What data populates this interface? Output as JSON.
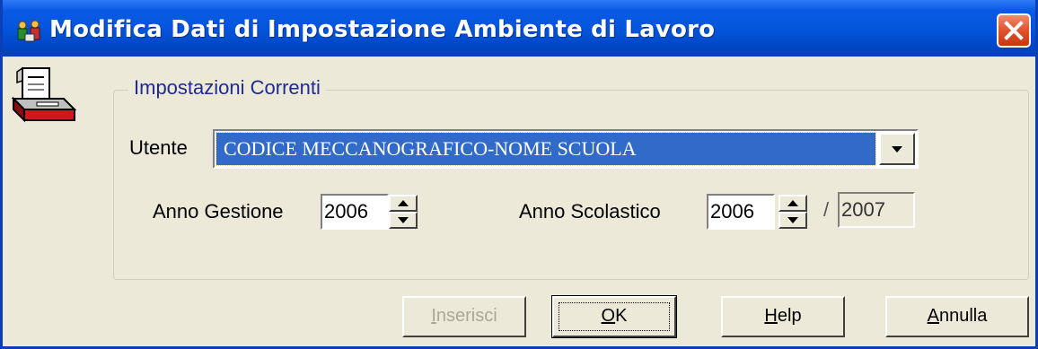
{
  "window": {
    "title": "Modifica Dati di Impostazione Ambiente di Lavoro",
    "title_icon": "people-settings-icon",
    "close_icon": "close-icon",
    "app_icon": "printer-document-icon"
  },
  "group": {
    "legend": "Impostazioni Correnti"
  },
  "utente": {
    "label": "Utente",
    "value": "CODICE MECCANOGRAFICO-NOME SCUOLA",
    "dropdown_icon": "chevron-down-icon"
  },
  "anno_gestione": {
    "label": "Anno Gestione",
    "value": "2006"
  },
  "anno_scolastico": {
    "label": "Anno Scolastico",
    "value_from": "2006",
    "separator": "/",
    "value_to": "2007"
  },
  "buttons": {
    "inserisci": {
      "label": "Inserisci",
      "mnemonic": "I",
      "rest": "nserisci",
      "enabled": false
    },
    "ok": {
      "label": "OK",
      "mnemonic": "O",
      "rest": "K"
    },
    "help": {
      "label": "Help",
      "mnemonic": "H",
      "rest": "elp"
    },
    "annulla": {
      "label": "Annulla",
      "mnemonic": "A",
      "rest": "nnulla"
    }
  },
  "colors": {
    "titlebar": "#0254d9",
    "selection": "#326ac9",
    "face": "#ece9d8",
    "close": "#e0522c"
  }
}
